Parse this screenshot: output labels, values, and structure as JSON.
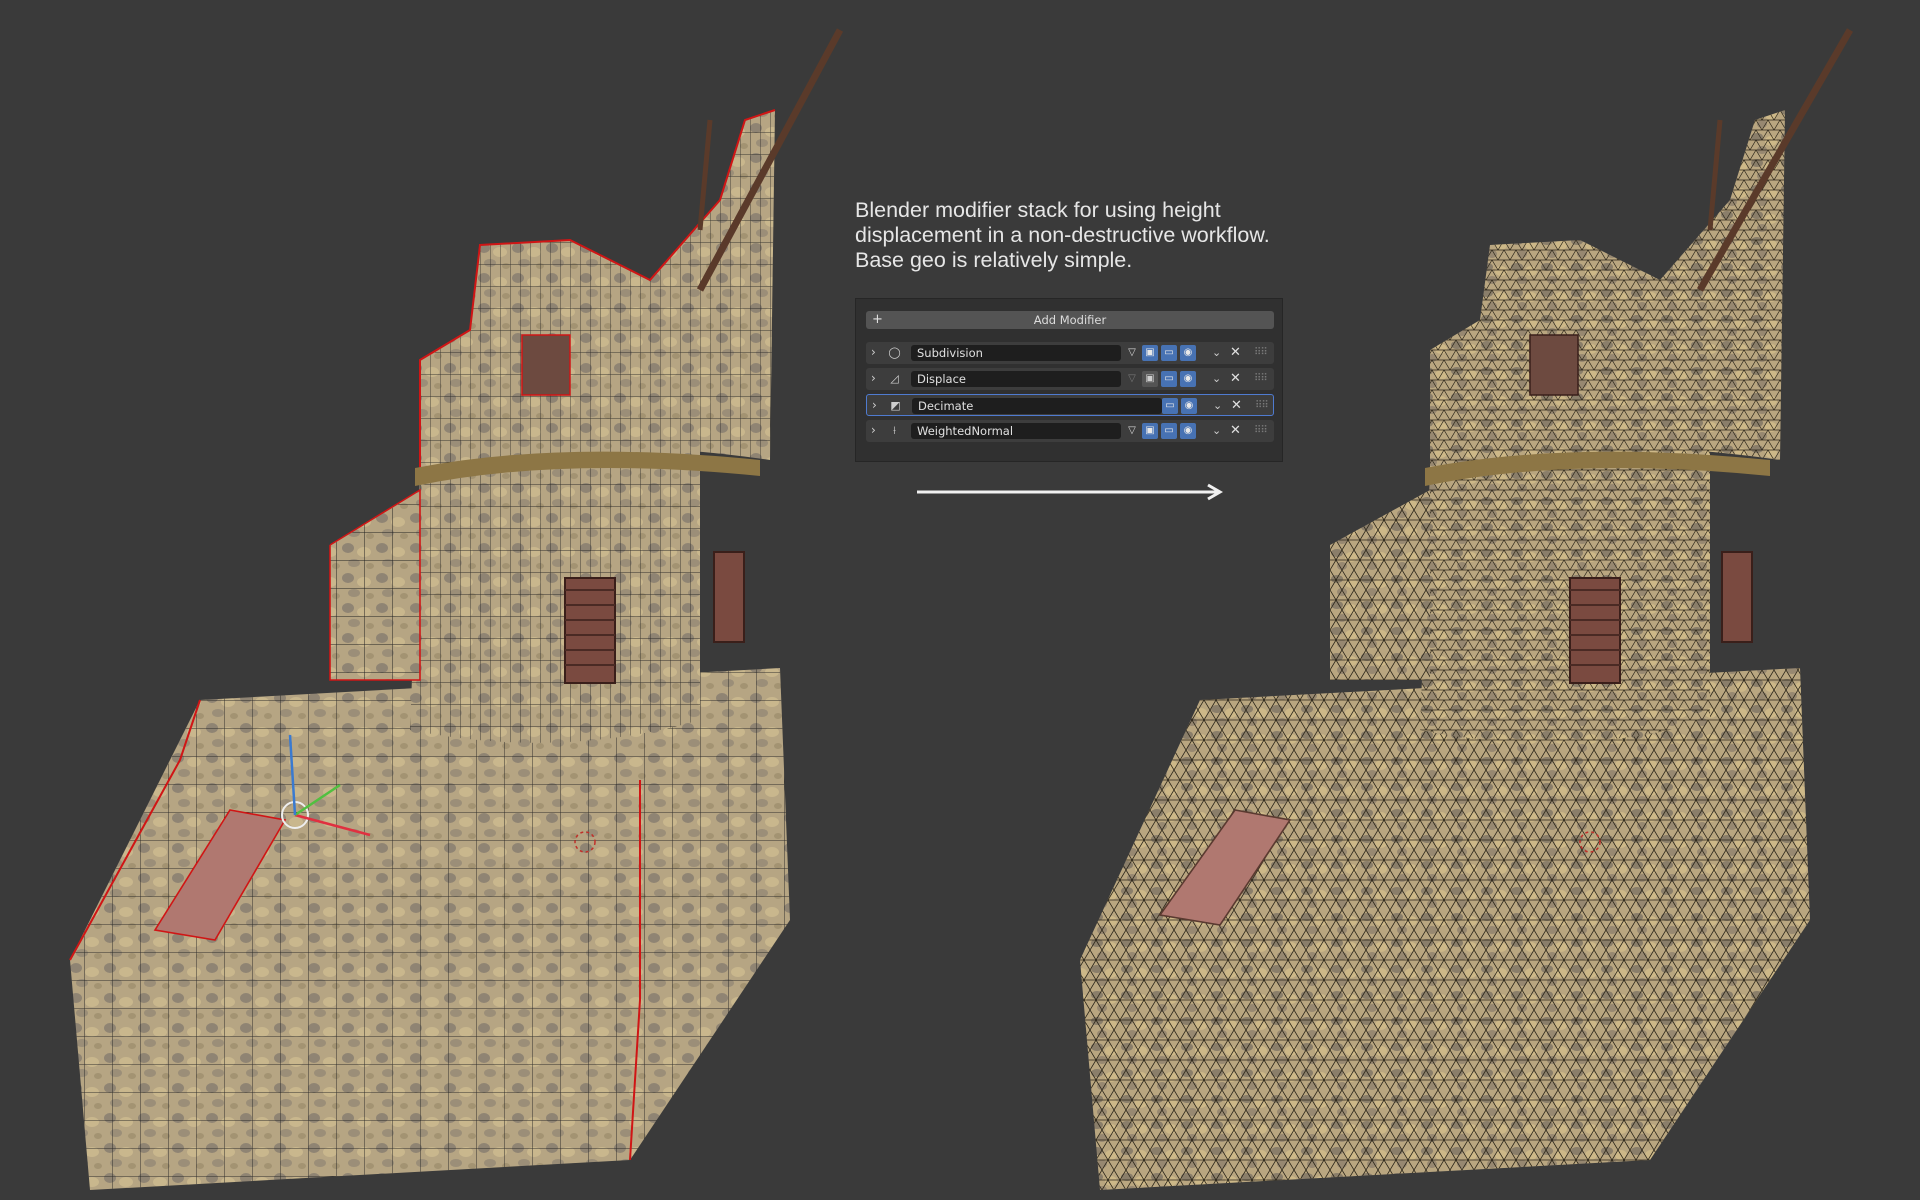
{
  "caption": {
    "lines": [
      "Blender modifier stack for using height",
      "displacement in a non-destructive workflow.",
      "Base geo is relatively simple."
    ]
  },
  "modifier_panel": {
    "add_label": "Add Modifier",
    "add_icon": "plus-icon",
    "modifiers": [
      {
        "name": "Subdivision",
        "icon": "subdivision-icon",
        "on_cage_disabled": false
      },
      {
        "name": "Displace",
        "icon": "displace-icon",
        "on_cage_disabled": true
      },
      {
        "name": "Decimate",
        "icon": "decimate-icon",
        "active": true
      },
      {
        "name": "WeightedNormal",
        "icon": "weighted-normal-icon",
        "on_cage_disabled": false
      }
    ]
  },
  "colors": {
    "background": "#3a3a3a",
    "panel": "#303030",
    "row": "#3d3d3d",
    "toggle_on": "#4772b3",
    "active_outline": "#4f7bd0",
    "wire_seam": "#d01515",
    "stone": "#b8a682"
  }
}
